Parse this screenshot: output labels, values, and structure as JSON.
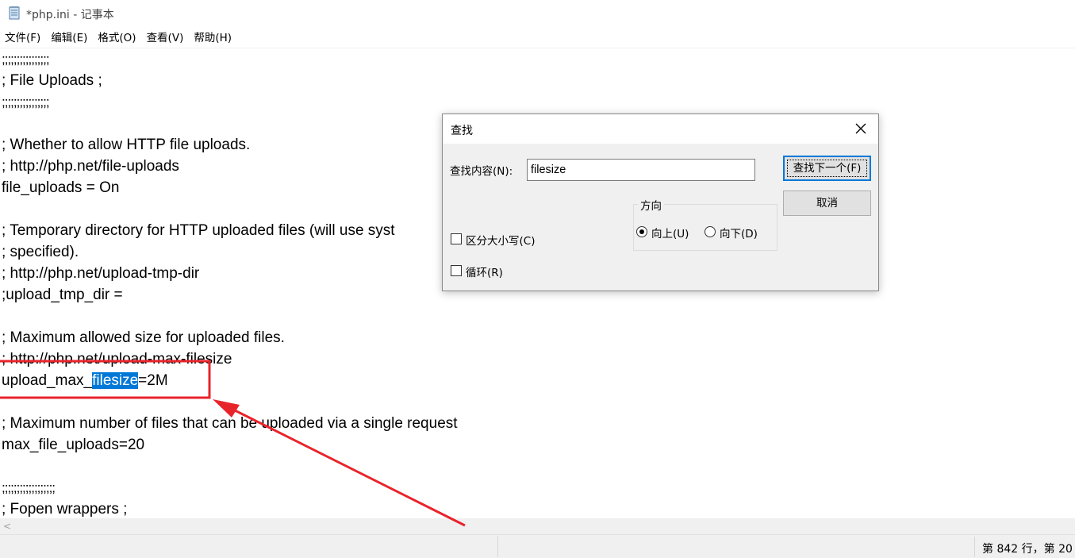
{
  "window": {
    "title": "*php.ini - 记事本",
    "icon": "notepad-icon"
  },
  "menu": {
    "items": [
      {
        "label": "文件(F)"
      },
      {
        "label": "编辑(E)"
      },
      {
        "label": "格式(O)"
      },
      {
        "label": "查看(V)"
      },
      {
        "label": "帮助(H)"
      }
    ]
  },
  "editor": {
    "lines": [
      ";;;;;;;;;;;;;;;;",
      "; File Uploads ;",
      ";;;;;;;;;;;;;;;;",
      "",
      "; Whether to allow HTTP file uploads.",
      "; http://php.net/file-uploads",
      "file_uploads = On",
      "",
      "; Temporary directory for HTTP uploaded files (will use syst",
      "; specified).",
      "; http://php.net/upload-tmp-dir",
      ";upload_tmp_dir =",
      "",
      "; Maximum allowed size for uploaded files.",
      "; http://php.net/upload-max-filesize",
      "",
      "",
      "; Maximum number of files that can be uploaded via a single request",
      "max_file_uploads=20",
      "",
      ";;;;;;;;;;;;;;;;;;",
      "; Fopen wrappers ;"
    ],
    "highlight_line": {
      "before": "upload_max_",
      "selected": "filesize",
      "after": "=2M"
    }
  },
  "status": {
    "position": "第 842 行，第 20"
  },
  "find_dialog": {
    "title": "查找",
    "find_label": "查找内容(N):",
    "find_value": "filesize",
    "find_next_label": "查找下一个(F)",
    "cancel_label": "取消",
    "direction_label": "方向",
    "up_label": "向上(U)",
    "down_label": "向下(D)",
    "direction_selected": "up",
    "match_case_label": "区分大小写(C)",
    "match_case_checked": false,
    "wrap_label": "循环(R)",
    "wrap_checked": false
  },
  "colors": {
    "selection": "#0078d7",
    "annotation": "#e8242b"
  }
}
